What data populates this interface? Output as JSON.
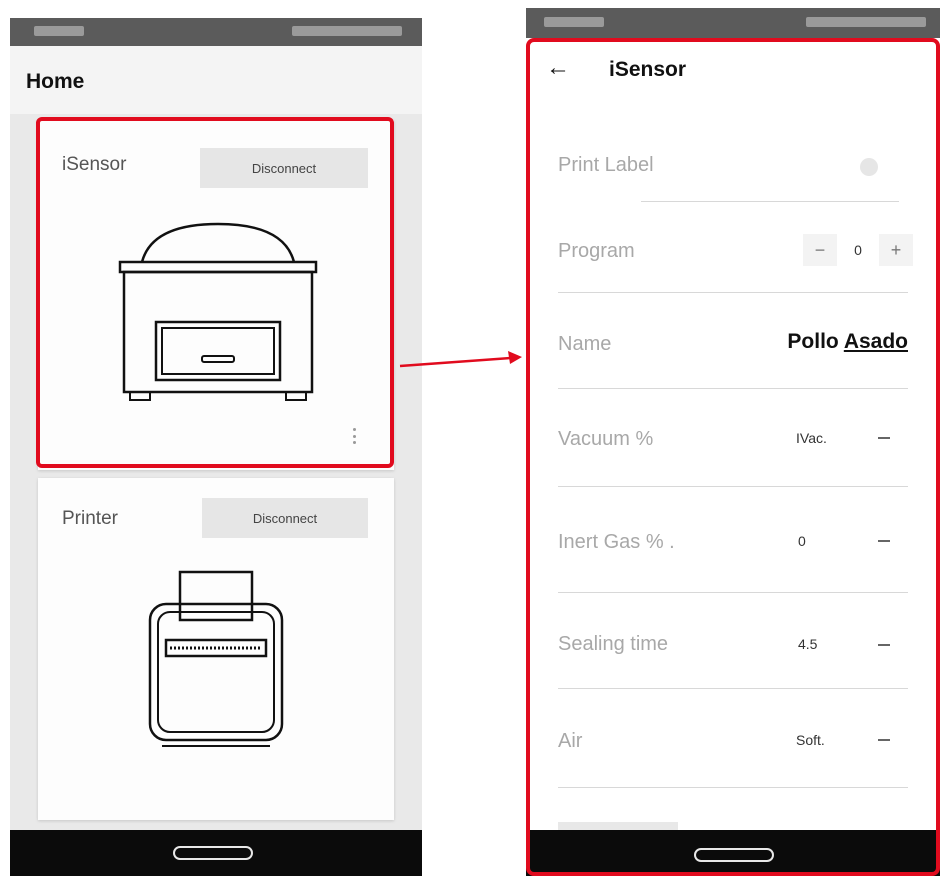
{
  "left_screen": {
    "page_title": "Home",
    "devices": [
      {
        "name": "iSensor",
        "button_label": "Disconnect",
        "illustration": "vacuum-machine-icon"
      },
      {
        "name": "Printer",
        "button_label": "Disconnect",
        "illustration": "printer-icon"
      }
    ]
  },
  "right_screen": {
    "title": "iSensor",
    "rows": [
      {
        "label": "Print Label",
        "control": "toggle"
      },
      {
        "label": "Program",
        "control": "stepper",
        "value": "0",
        "minus": "−",
        "plus": "+"
      },
      {
        "label": "Name",
        "value_plain": "Pollo ",
        "value_underlined": "Asado"
      },
      {
        "label": "Vacuum %",
        "value": "IVac."
      },
      {
        "label": "Inert Gas % .",
        "value": "0"
      },
      {
        "label": "Sealing time",
        "value": "4.5"
      },
      {
        "label": "Air",
        "value": "Soft."
      }
    ]
  },
  "colors": {
    "highlight": "#e10b1e",
    "nav_bar": "#0b0b0b",
    "status_bar": "#5b5b5b"
  }
}
